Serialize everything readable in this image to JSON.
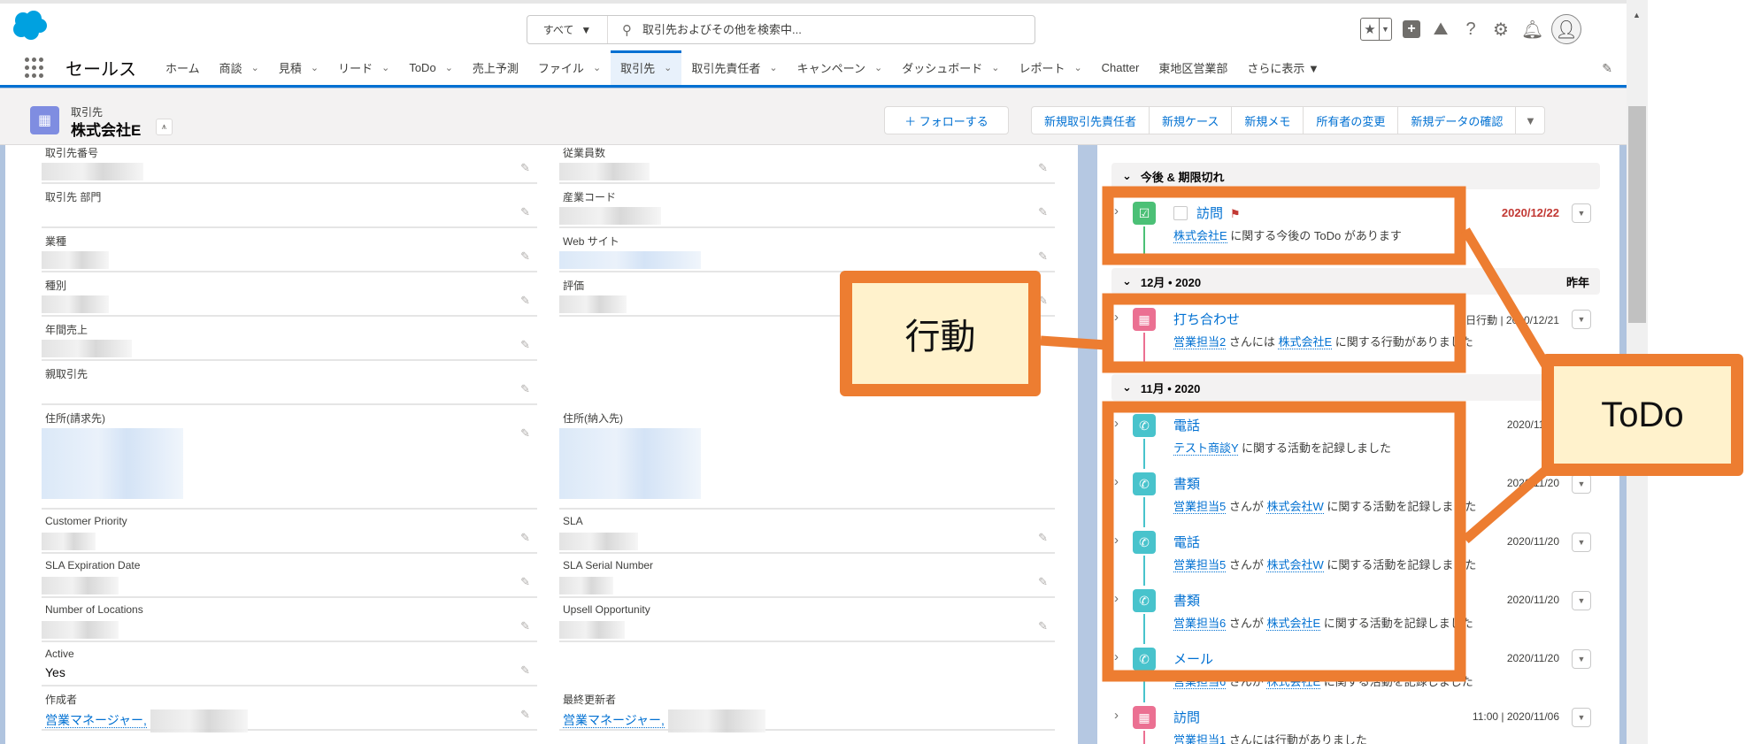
{
  "header": {
    "search_scope": "すべて",
    "search_placeholder": "取引先およびその他を検索中...",
    "icons": [
      "star-favorites-icon",
      "add-icon",
      "trailhead-icon",
      "help-icon",
      "settings-icon",
      "notifications-bell-icon",
      "user-avatar-icon"
    ]
  },
  "nav": {
    "app_name": "セールス",
    "tabs": [
      {
        "label": "ホーム",
        "menu": false
      },
      {
        "label": "商談",
        "menu": true
      },
      {
        "label": "見積",
        "menu": true
      },
      {
        "label": "リード",
        "menu": true
      },
      {
        "label": "ToDo",
        "menu": true
      },
      {
        "label": "売上予測",
        "menu": false
      },
      {
        "label": "ファイル",
        "menu": true
      },
      {
        "label": "取引先",
        "menu": true,
        "active": true
      },
      {
        "label": "取引先責任者",
        "menu": true
      },
      {
        "label": "キャンペーン",
        "menu": true
      },
      {
        "label": "ダッシュボード",
        "menu": true
      },
      {
        "label": "レポート",
        "menu": true
      },
      {
        "label": "Chatter",
        "menu": false
      },
      {
        "label": "東地区営業部",
        "menu": false
      },
      {
        "label": "さらに表示 ▼",
        "menu": false
      }
    ]
  },
  "record": {
    "type": "取引先",
    "name": "株式会社E",
    "follow_label": "＋ フォローする",
    "actions": [
      "新規取引先責任者",
      "新規ケース",
      "新規メモ",
      "所有者の変更",
      "新規データの確認"
    ],
    "more_label": "▼"
  },
  "fields": {
    "left": [
      {
        "label": "取引先番号",
        "redacted": "gray"
      },
      {
        "label": "取引先 部門"
      },
      {
        "label": "業種",
        "redacted": "gray"
      },
      {
        "label": "種別",
        "redacted": "gray"
      },
      {
        "label": "年間売上",
        "redacted": "gray"
      },
      {
        "label": "親取引先"
      },
      {
        "label": "住所(請求先)",
        "redacted": "blue",
        "tall": true
      },
      {
        "label": "Customer Priority",
        "redacted": "gray"
      },
      {
        "label": "SLA Expiration Date",
        "redacted": "gray"
      },
      {
        "label": "Number of Locations",
        "redacted": "gray"
      },
      {
        "label": "Active",
        "value": "Yes"
      },
      {
        "label": "作成者",
        "link": "営業マネージャー,",
        "redacted": "inline"
      }
    ],
    "right": [
      {
        "label": "従業員数",
        "redacted": "gray"
      },
      {
        "label": "産業コード",
        "redacted": "gray"
      },
      {
        "label": "Web サイト",
        "redacted": "blue"
      },
      {
        "label": "評価",
        "redacted": "gray"
      },
      {
        "blank": true
      },
      {
        "blank": true
      },
      {
        "label": "住所(納入先)",
        "redacted": "blue",
        "tall": true,
        "noedit": true
      },
      {
        "label": "SLA",
        "redacted": "gray"
      },
      {
        "label": "SLA Serial Number",
        "redacted": "gray"
      },
      {
        "label": "Upsell Opportunity",
        "redacted": "gray"
      },
      {
        "blank": true
      },
      {
        "label": "最終更新者",
        "link": "営業マネージャー,",
        "redacted": "inline",
        "noedit": true
      }
    ]
  },
  "activity": {
    "groups": [
      {
        "label": "今後 & 期限切れ",
        "right": ""
      },
      {
        "label": "12月 • 2020",
        "right": "昨年"
      },
      {
        "label": "11月 • 2020",
        "right": ""
      }
    ],
    "items": [
      {
        "group": 0,
        "kind": "task",
        "title": "訪問",
        "checkbox": true,
        "flag": true,
        "date": "2020/12/22",
        "overdue": true,
        "sub": [
          {
            "link": "株式会社E"
          },
          {
            "text": " に関する今後の ToDo があります"
          }
        ]
      },
      {
        "group": 1,
        "kind": "event",
        "title": "打ち合わせ",
        "date": "終日行動 | 2020/12/21",
        "sub": [
          {
            "link": "営業担当2"
          },
          {
            "text": " さんには "
          },
          {
            "link": "株式会社E"
          },
          {
            "text": " に関する行動がありました"
          }
        ]
      },
      {
        "group": 2,
        "kind": "call",
        "title": "電話",
        "date": "2020/11/20",
        "sub": [
          {
            "link": "テスト商談Y"
          },
          {
            "text": " に関する活動を記録しました"
          }
        ]
      },
      {
        "group": 2,
        "kind": "call",
        "title": "書類",
        "date": "2020/11/20",
        "sub": [
          {
            "link": "営業担当5"
          },
          {
            "text": " さんが "
          },
          {
            "link": "株式会社W"
          },
          {
            "text": " に関する活動を記録しました"
          }
        ]
      },
      {
        "group": 2,
        "kind": "call",
        "title": "電話",
        "date": "2020/11/20",
        "sub": [
          {
            "link": "営業担当5"
          },
          {
            "text": " さんが "
          },
          {
            "link": "株式会社W"
          },
          {
            "text": " に関する活動を記録しました"
          }
        ]
      },
      {
        "group": 2,
        "kind": "call",
        "title": "書類",
        "date": "2020/11/20",
        "sub": [
          {
            "link": "営業担当6"
          },
          {
            "text": " さんが "
          },
          {
            "link": "株式会社E"
          },
          {
            "text": " に関する活動を記録しました"
          }
        ]
      },
      {
        "group": 2,
        "kind": "call",
        "title": "メール",
        "date": "2020/11/20",
        "sub": [
          {
            "link": "営業担当6"
          },
          {
            "text": " さんが "
          },
          {
            "link": "株式会社E"
          },
          {
            "text": " に関する活動を記録しました"
          }
        ]
      },
      {
        "group": 2,
        "kind": "event",
        "title": "訪問",
        "date": "11:00 | 2020/11/06",
        "sub": [
          {
            "link": "営業担当1"
          },
          {
            "text": " さんには行動がありました"
          }
        ]
      }
    ]
  },
  "annotations": {
    "event_label": "行動",
    "todo_label": "ToDo"
  },
  "colors": {
    "brand": "#00a1e0",
    "link": "#0070d2",
    "task": "#4bc076",
    "event": "#eb7092",
    "call": "#48c3cc",
    "annotation": "#ed7d31",
    "callout_fill": "#fff2cc",
    "overdue": "#c23934"
  }
}
